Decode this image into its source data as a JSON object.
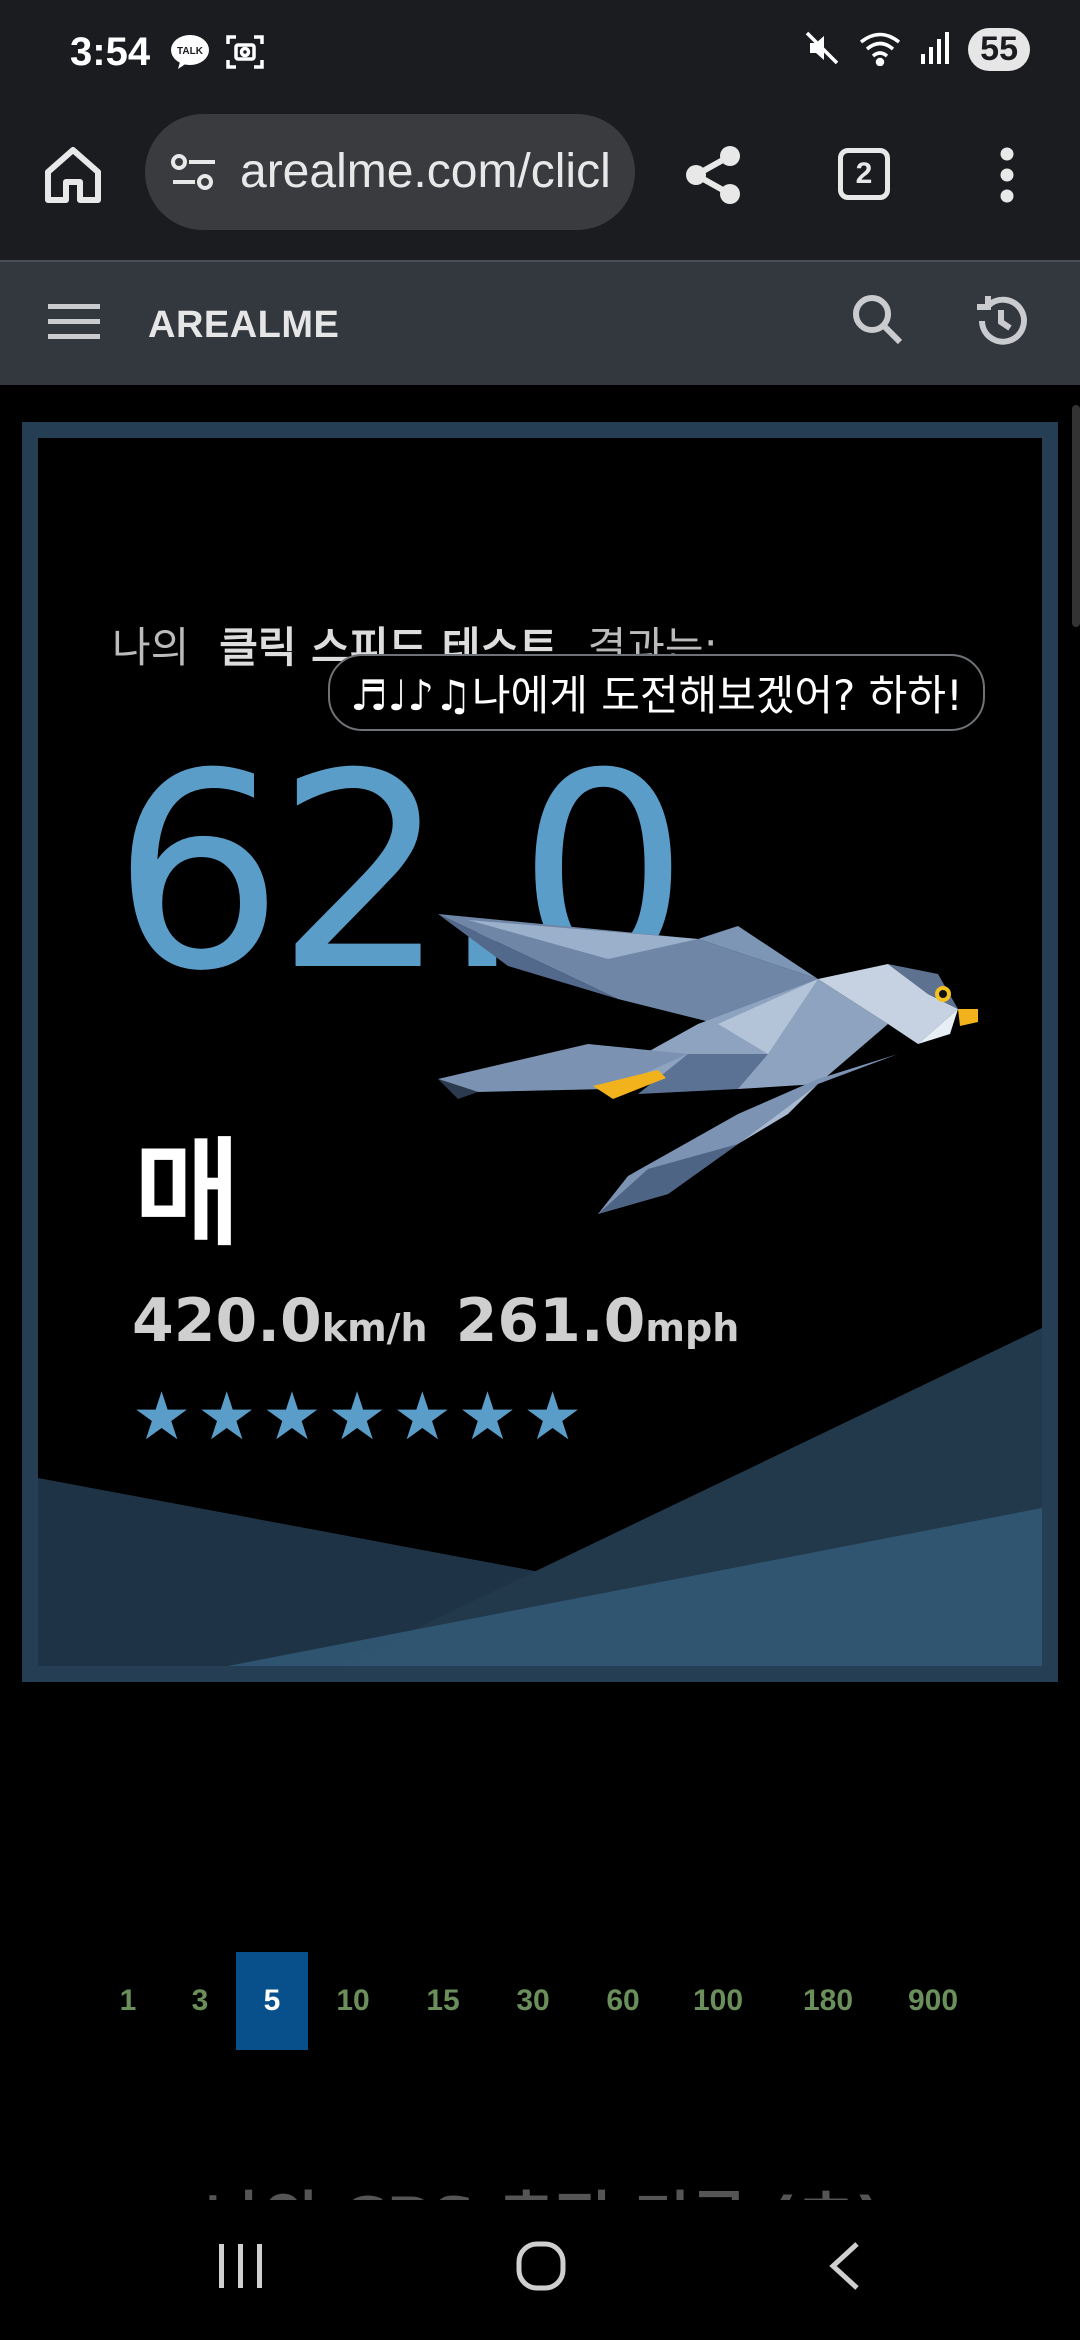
{
  "status": {
    "time": "3:54",
    "notification_icons": [
      "talk-icon",
      "screenshot-icon"
    ],
    "right_icons": [
      "mute-icon",
      "wifi-icon",
      "signal-icon"
    ],
    "battery": "55"
  },
  "browser": {
    "url": "arealme.com/clicl",
    "tab_count": "2"
  },
  "site": {
    "logo": "AREALME"
  },
  "result": {
    "heading_prefix": "나의",
    "heading_bold": "클릭 스피드 테스트",
    "heading_suffix": "결과는:",
    "bubble": "♬♩♪♫나에게 도전해보겠어? 하하!",
    "score": "62.0",
    "animal": "매",
    "speed_kmh": "420.0",
    "kmh_unit": "km/h",
    "speed_mph": "261.0",
    "mph_unit": "mph",
    "stars": 7,
    "colors": {
      "accent": "#5b9dc9",
      "card_border": "#263e53"
    }
  },
  "pagination": {
    "pages": [
      "1",
      "3",
      "5",
      "10",
      "15",
      "30",
      "60",
      "100",
      "180",
      "900"
    ],
    "active": "5"
  },
  "below_heading": "나의 CPS 측정 기록 (초)"
}
